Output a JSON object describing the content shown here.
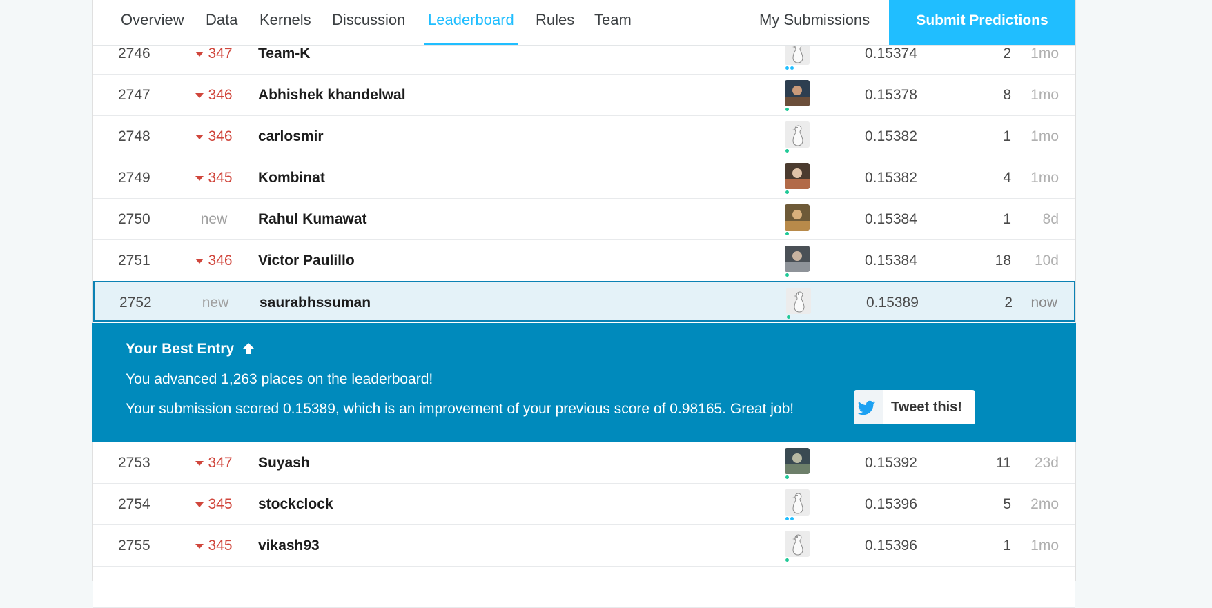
{
  "tabs": {
    "overview": "Overview",
    "data": "Data",
    "kernels": "Kernels",
    "discussion": "Discussion",
    "leaderboard": "Leaderboard",
    "rules": "Rules",
    "team": "Team",
    "my_submissions": "My Submissions",
    "submit": "Submit Predictions"
  },
  "colors": {
    "accent": "#20beff",
    "banner": "#008abc",
    "rank_drop": "#d0463c",
    "online_dot": "#20c997"
  },
  "rows_before": [
    {
      "rank": "2746",
      "change": "347",
      "name": "Team-K",
      "avatar": "goose",
      "score": "0.15374",
      "entries": "2",
      "last": "1mo",
      "team": true
    },
    {
      "rank": "2747",
      "change": "346",
      "name": "Abhishek khandelwal",
      "avatar": "photo",
      "score": "0.15378",
      "entries": "8",
      "last": "1mo"
    },
    {
      "rank": "2748",
      "change": "346",
      "name": "carlosmir",
      "avatar": "goose",
      "score": "0.15382",
      "entries": "1",
      "last": "1mo"
    },
    {
      "rank": "2749",
      "change": "345",
      "name": "Kombinat",
      "avatar": "photo",
      "score": "0.15382",
      "entries": "4",
      "last": "1mo"
    },
    {
      "rank": "2750",
      "change": "new",
      "name": "Rahul Kumawat",
      "avatar": "photo",
      "score": "0.15384",
      "entries": "1",
      "last": "8d"
    },
    {
      "rank": "2751",
      "change": "346",
      "name": "Victor Paulillo",
      "avatar": "photo",
      "score": "0.15384",
      "entries": "18",
      "last": "10d"
    }
  ],
  "my_row": {
    "rank": "2752",
    "change": "new",
    "name": "saurabhssuman",
    "avatar": "goose",
    "score": "0.15389",
    "entries": "2",
    "last": "now"
  },
  "banner": {
    "title": "Your Best Entry",
    "title_icon": "arrow-up-icon",
    "line1": "You advanced 1,263 places on the leaderboard!",
    "line2": "Your submission scored 0.15389, which is an improvement of your previous score of 0.98165. Great job!",
    "tweet_label": "Tweet this!"
  },
  "rows_after": [
    {
      "rank": "2753",
      "change": "347",
      "name": "Suyash",
      "avatar": "photo",
      "score": "0.15392",
      "entries": "11",
      "last": "23d"
    },
    {
      "rank": "2754",
      "change": "345",
      "name": "stockclock",
      "avatar": "goose",
      "score": "0.15396",
      "entries": "5",
      "last": "2mo",
      "team": true
    },
    {
      "rank": "2755",
      "change": "345",
      "name": "vikash93",
      "avatar": "goose",
      "score": "0.15396",
      "entries": "1",
      "last": "1mo"
    }
  ]
}
